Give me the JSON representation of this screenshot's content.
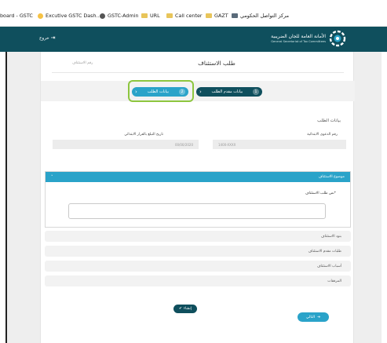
{
  "bookmarks": [
    {
      "label": "board - GSTC",
      "icon": "page-icon"
    },
    {
      "label": "Excutive GSTC Dash...",
      "icon": "sun-icon"
    },
    {
      "label": "GSTC-Admin",
      "icon": "globe-icon"
    },
    {
      "label": "URL",
      "icon": "folder-icon"
    },
    {
      "label": "Call center",
      "icon": "folder-icon"
    },
    {
      "label": "GAZT",
      "icon": "folder-icon"
    },
    {
      "label": "مركز التواصل الحكومي",
      "icon": "site-icon"
    }
  ],
  "header": {
    "logout_label": "خروج",
    "org_name_ar": "الأمانة العامة للجان الضريبية",
    "org_name_en": "General Secretariat of Tax Committees"
  },
  "page": {
    "title": "طلب الاستئناف",
    "request_number_label": "رقم الاستئناف"
  },
  "steps": [
    {
      "number": "1",
      "label": "بيانات مقدم الطلب",
      "arrow": "›"
    },
    {
      "number": "2",
      "label": "بيانات الطلب",
      "arrow": "›"
    }
  ],
  "request_data": {
    "section_title": "بيانات الطلب",
    "fields": [
      {
        "label": "رقم الدعوى الابتدائية",
        "value": "1400-XXXX"
      },
      {
        "label": "تاريخ التبلغ بالقرار الابتدائي",
        "value": "00/00/2020"
      }
    ]
  },
  "appeal_panel": {
    "title": "موضوع الاستئناف",
    "chevron": "˅",
    "field_label": "نص طلب الاستئناف*",
    "field_value": ""
  },
  "accordion": [
    "بنود الاستئناف",
    "طلبات مقدم الاستئناف",
    "أسباب الاستئناف",
    "المرفقات"
  ],
  "actions": {
    "save_label": "إنشاء",
    "save_icon": "✔",
    "next_label": "التالي",
    "next_icon": "➔"
  },
  "colors": {
    "header_bg": "#0f4f5d",
    "accent": "#2aa3c9",
    "highlight": "#8dc63f"
  }
}
